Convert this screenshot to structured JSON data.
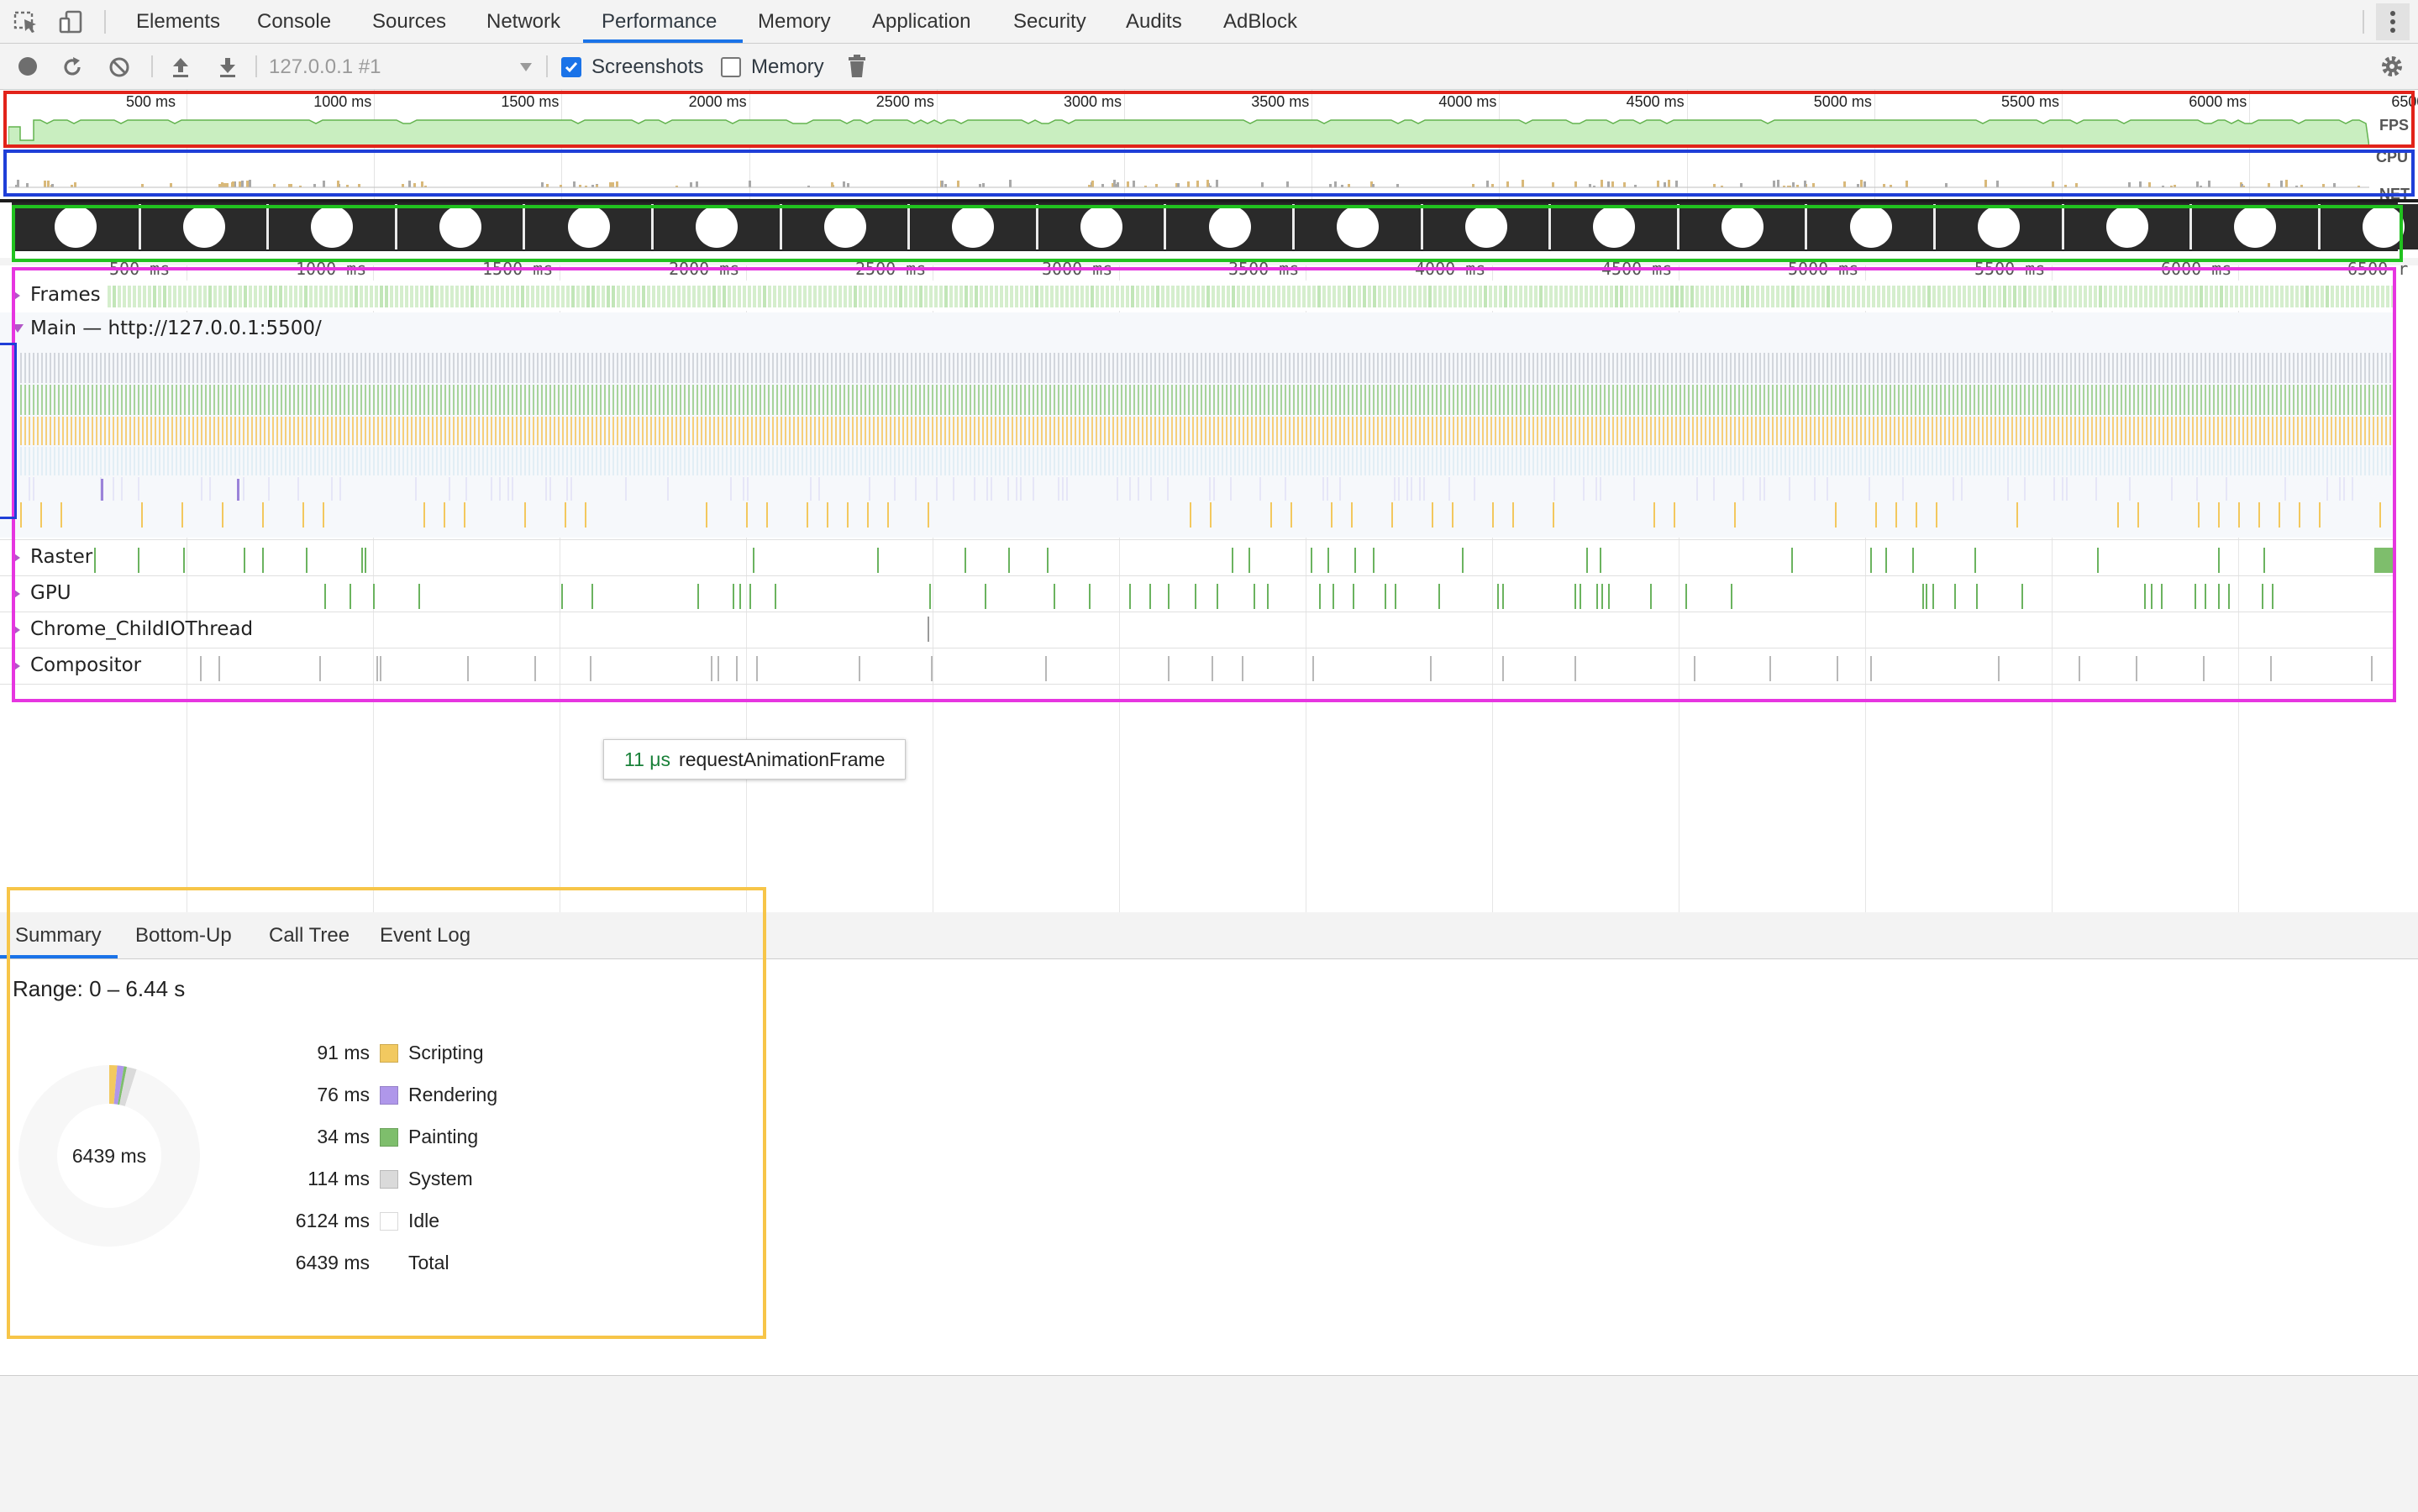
{
  "tabs": [
    {
      "label": "Elements"
    },
    {
      "label": "Console"
    },
    {
      "label": "Sources"
    },
    {
      "label": "Network"
    },
    {
      "label": "Performance"
    },
    {
      "label": "Memory"
    },
    {
      "label": "Application"
    },
    {
      "label": "Security"
    },
    {
      "label": "Audits"
    },
    {
      "label": "AdBlock"
    }
  ],
  "active_tab": "Performance",
  "toolbar": {
    "target": "127.0.0.1 #1",
    "screenshots_label": "Screenshots",
    "screenshots_checked": true,
    "memory_label": "Memory",
    "memory_checked": false
  },
  "overview": {
    "ticks": [
      "500 ms",
      "1000 ms",
      "1500 ms",
      "2000 ms",
      "2500 ms",
      "3000 ms",
      "3500 ms",
      "4000 ms",
      "4500 ms",
      "5000 ms",
      "5500 ms",
      "6000 ms",
      "6500"
    ],
    "fps_label": "FPS",
    "cpu_label": "CPU",
    "net_label": "NET"
  },
  "flame": {
    "ticks": [
      "500 ms",
      "1000 ms",
      "1500 ms",
      "2000 ms",
      "2500 ms",
      "3000 ms",
      "3500 ms",
      "4000 ms",
      "4500 ms",
      "5000 ms",
      "5500 ms",
      "6000 ms",
      "6500 r"
    ],
    "tracks": {
      "frames": "Frames",
      "main": "Main — http://127.0.0.1:5500/",
      "raster": "Raster",
      "gpu": "GPU",
      "childio": "Chrome_ChildIOThread",
      "compositor": "Compositor"
    },
    "tooltip": {
      "duration": "11 μs",
      "name": "requestAnimationFrame"
    }
  },
  "bottom_tabs": [
    {
      "label": "Summary"
    },
    {
      "label": "Bottom-Up"
    },
    {
      "label": "Call Tree"
    },
    {
      "label": "Event Log"
    }
  ],
  "active_bottom_tab": "Summary",
  "summary": {
    "range": "Range: 0 – 6.44 s",
    "total_center": "6439 ms",
    "rows": [
      {
        "value": "91 ms",
        "label": "Scripting",
        "color": "#f2c960"
      },
      {
        "value": "76 ms",
        "label": "Rendering",
        "color": "#af97ea"
      },
      {
        "value": "34 ms",
        "label": "Painting",
        "color": "#7ebe6c"
      },
      {
        "value": "114 ms",
        "label": "System",
        "color": "#dadada"
      },
      {
        "value": "6124 ms",
        "label": "Idle",
        "color": "#ffffff"
      },
      {
        "value": "6439 ms",
        "label": "Total",
        "color": null
      }
    ]
  },
  "colors": {
    "accent": "#1a73e8",
    "annot_red": "#e2231a",
    "annot_blue": "#1f3fd8",
    "annot_green": "#21c21f",
    "annot_magenta": "#e635e0",
    "annot_yellow": "#f7c548"
  }
}
